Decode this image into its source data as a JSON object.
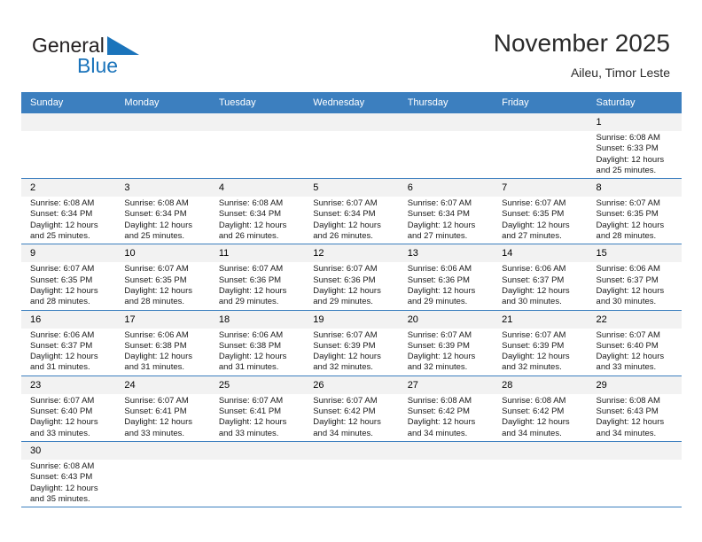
{
  "brand": {
    "name_part1": "General",
    "name_part2": "Blue",
    "mark_icon": "triangle-flag-icon",
    "accent_color": "#1b74bb"
  },
  "header": {
    "title": "November 2025",
    "subtitle": "Aileu, Timor Leste"
  },
  "calendar": {
    "header_bg": "#3c7fbf",
    "daynum_bg": "#f2f2f2",
    "weekdays": [
      "Sunday",
      "Monday",
      "Tuesday",
      "Wednesday",
      "Thursday",
      "Friday",
      "Saturday"
    ],
    "weeks": [
      [
        {
          "day": "",
          "lines": []
        },
        {
          "day": "",
          "lines": []
        },
        {
          "day": "",
          "lines": []
        },
        {
          "day": "",
          "lines": []
        },
        {
          "day": "",
          "lines": []
        },
        {
          "day": "",
          "lines": []
        },
        {
          "day": "1",
          "lines": [
            "Sunrise: 6:08 AM",
            "Sunset: 6:33 PM",
            "Daylight: 12 hours",
            "and 25 minutes."
          ]
        }
      ],
      [
        {
          "day": "2",
          "lines": [
            "Sunrise: 6:08 AM",
            "Sunset: 6:34 PM",
            "Daylight: 12 hours",
            "and 25 minutes."
          ]
        },
        {
          "day": "3",
          "lines": [
            "Sunrise: 6:08 AM",
            "Sunset: 6:34 PM",
            "Daylight: 12 hours",
            "and 25 minutes."
          ]
        },
        {
          "day": "4",
          "lines": [
            "Sunrise: 6:08 AM",
            "Sunset: 6:34 PM",
            "Daylight: 12 hours",
            "and 26 minutes."
          ]
        },
        {
          "day": "5",
          "lines": [
            "Sunrise: 6:07 AM",
            "Sunset: 6:34 PM",
            "Daylight: 12 hours",
            "and 26 minutes."
          ]
        },
        {
          "day": "6",
          "lines": [
            "Sunrise: 6:07 AM",
            "Sunset: 6:34 PM",
            "Daylight: 12 hours",
            "and 27 minutes."
          ]
        },
        {
          "day": "7",
          "lines": [
            "Sunrise: 6:07 AM",
            "Sunset: 6:35 PM",
            "Daylight: 12 hours",
            "and 27 minutes."
          ]
        },
        {
          "day": "8",
          "lines": [
            "Sunrise: 6:07 AM",
            "Sunset: 6:35 PM",
            "Daylight: 12 hours",
            "and 28 minutes."
          ]
        }
      ],
      [
        {
          "day": "9",
          "lines": [
            "Sunrise: 6:07 AM",
            "Sunset: 6:35 PM",
            "Daylight: 12 hours",
            "and 28 minutes."
          ]
        },
        {
          "day": "10",
          "lines": [
            "Sunrise: 6:07 AM",
            "Sunset: 6:35 PM",
            "Daylight: 12 hours",
            "and 28 minutes."
          ]
        },
        {
          "day": "11",
          "lines": [
            "Sunrise: 6:07 AM",
            "Sunset: 6:36 PM",
            "Daylight: 12 hours",
            "and 29 minutes."
          ]
        },
        {
          "day": "12",
          "lines": [
            "Sunrise: 6:07 AM",
            "Sunset: 6:36 PM",
            "Daylight: 12 hours",
            "and 29 minutes."
          ]
        },
        {
          "day": "13",
          "lines": [
            "Sunrise: 6:06 AM",
            "Sunset: 6:36 PM",
            "Daylight: 12 hours",
            "and 29 minutes."
          ]
        },
        {
          "day": "14",
          "lines": [
            "Sunrise: 6:06 AM",
            "Sunset: 6:37 PM",
            "Daylight: 12 hours",
            "and 30 minutes."
          ]
        },
        {
          "day": "15",
          "lines": [
            "Sunrise: 6:06 AM",
            "Sunset: 6:37 PM",
            "Daylight: 12 hours",
            "and 30 minutes."
          ]
        }
      ],
      [
        {
          "day": "16",
          "lines": [
            "Sunrise: 6:06 AM",
            "Sunset: 6:37 PM",
            "Daylight: 12 hours",
            "and 31 minutes."
          ]
        },
        {
          "day": "17",
          "lines": [
            "Sunrise: 6:06 AM",
            "Sunset: 6:38 PM",
            "Daylight: 12 hours",
            "and 31 minutes."
          ]
        },
        {
          "day": "18",
          "lines": [
            "Sunrise: 6:06 AM",
            "Sunset: 6:38 PM",
            "Daylight: 12 hours",
            "and 31 minutes."
          ]
        },
        {
          "day": "19",
          "lines": [
            "Sunrise: 6:07 AM",
            "Sunset: 6:39 PM",
            "Daylight: 12 hours",
            "and 32 minutes."
          ]
        },
        {
          "day": "20",
          "lines": [
            "Sunrise: 6:07 AM",
            "Sunset: 6:39 PM",
            "Daylight: 12 hours",
            "and 32 minutes."
          ]
        },
        {
          "day": "21",
          "lines": [
            "Sunrise: 6:07 AM",
            "Sunset: 6:39 PM",
            "Daylight: 12 hours",
            "and 32 minutes."
          ]
        },
        {
          "day": "22",
          "lines": [
            "Sunrise: 6:07 AM",
            "Sunset: 6:40 PM",
            "Daylight: 12 hours",
            "and 33 minutes."
          ]
        }
      ],
      [
        {
          "day": "23",
          "lines": [
            "Sunrise: 6:07 AM",
            "Sunset: 6:40 PM",
            "Daylight: 12 hours",
            "and 33 minutes."
          ]
        },
        {
          "day": "24",
          "lines": [
            "Sunrise: 6:07 AM",
            "Sunset: 6:41 PM",
            "Daylight: 12 hours",
            "and 33 minutes."
          ]
        },
        {
          "day": "25",
          "lines": [
            "Sunrise: 6:07 AM",
            "Sunset: 6:41 PM",
            "Daylight: 12 hours",
            "and 33 minutes."
          ]
        },
        {
          "day": "26",
          "lines": [
            "Sunrise: 6:07 AM",
            "Sunset: 6:42 PM",
            "Daylight: 12 hours",
            "and 34 minutes."
          ]
        },
        {
          "day": "27",
          "lines": [
            "Sunrise: 6:08 AM",
            "Sunset: 6:42 PM",
            "Daylight: 12 hours",
            "and 34 minutes."
          ]
        },
        {
          "day": "28",
          "lines": [
            "Sunrise: 6:08 AM",
            "Sunset: 6:42 PM",
            "Daylight: 12 hours",
            "and 34 minutes."
          ]
        },
        {
          "day": "29",
          "lines": [
            "Sunrise: 6:08 AM",
            "Sunset: 6:43 PM",
            "Daylight: 12 hours",
            "and 34 minutes."
          ]
        }
      ],
      [
        {
          "day": "30",
          "lines": [
            "Sunrise: 6:08 AM",
            "Sunset: 6:43 PM",
            "Daylight: 12 hours",
            "and 35 minutes."
          ]
        },
        {
          "day": "",
          "lines": []
        },
        {
          "day": "",
          "lines": []
        },
        {
          "day": "",
          "lines": []
        },
        {
          "day": "",
          "lines": []
        },
        {
          "day": "",
          "lines": []
        },
        {
          "day": "",
          "lines": []
        }
      ]
    ]
  }
}
